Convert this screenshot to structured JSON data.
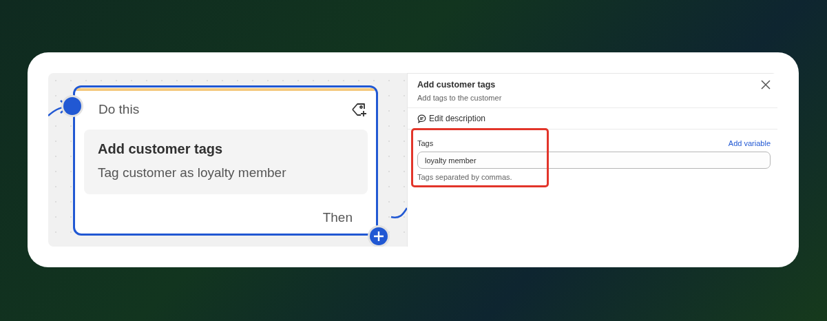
{
  "node": {
    "header": "Do this",
    "title": "Add customer tags",
    "description": "Tag customer as loyalty member",
    "next_label": "Then"
  },
  "panel": {
    "title": "Add customer tags",
    "subtitle": "Add tags to the customer",
    "edit_link": "Edit description",
    "fields": [
      {
        "label": "Tags",
        "action": "Add variable",
        "value": "loyalty member",
        "help": "Tags separated by commas.",
        "highlighted": true
      }
    ]
  }
}
